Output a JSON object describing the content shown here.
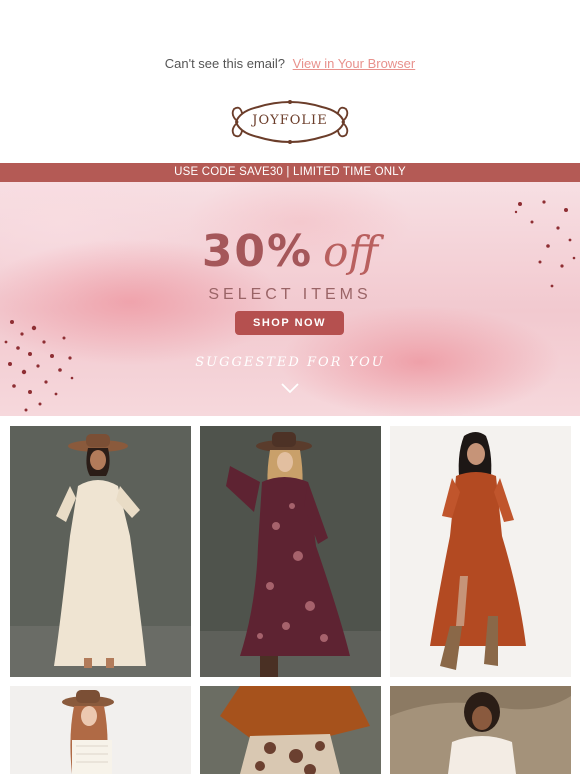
{
  "preheader": {
    "text": "Can't see this email?",
    "link": "View in Your Browser"
  },
  "logo": {
    "text": "JOYFOLIE"
  },
  "promo_bar": {
    "text": "USE CODE SAVE30 | LIMITED TIME ONLY"
  },
  "hero": {
    "percent": "30%",
    "off": "off",
    "subtitle": "SELECT ITEMS",
    "button": "SHOP NOW",
    "suggested": "SUGGESTED FOR YOU"
  },
  "colors": {
    "accent": "#b45a55",
    "link": "#e8918c",
    "button": "#b5504f"
  },
  "products": [
    {
      "name": "cream dress with brown hat",
      "bg": "#5d615a"
    },
    {
      "name": "plum floral maxi dress with hat",
      "bg": "#4f534c"
    },
    {
      "name": "rust tiered dress with boots",
      "bg": "#f4f2ef"
    },
    {
      "name": "white lace top with hat",
      "bg": "#f2f0ee"
    },
    {
      "name": "rust sweater with patterned pants",
      "bg": "#6b6d63"
    },
    {
      "name": "white top outdoors",
      "bg": "#8c7a63"
    }
  ]
}
